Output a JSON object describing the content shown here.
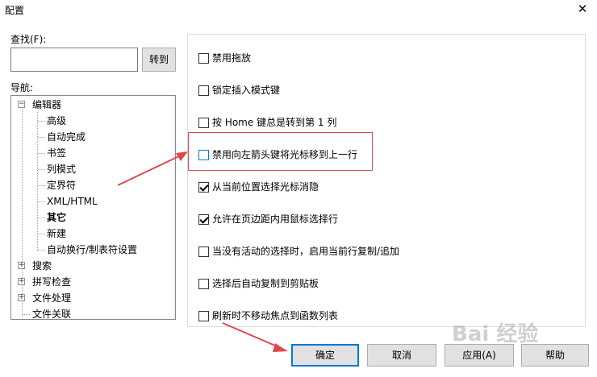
{
  "window": {
    "title": "配置",
    "close_glyph": "✕"
  },
  "find": {
    "label": "查找(F):",
    "value": "",
    "goto_label": "转到"
  },
  "nav": {
    "label": "导航:",
    "tree": [
      {
        "label": "编辑器",
        "level": 0,
        "toggle": "−"
      },
      {
        "label": "高级",
        "level": 1
      },
      {
        "label": "自动完成",
        "level": 1
      },
      {
        "label": "书签",
        "level": 1
      },
      {
        "label": "列模式",
        "level": 1
      },
      {
        "label": "定界符",
        "level": 1
      },
      {
        "label": "XML/HTML",
        "level": 1
      },
      {
        "label": "其它",
        "level": 1,
        "selected": true
      },
      {
        "label": "新建",
        "level": 1
      },
      {
        "label": "自动换行/制表符设置",
        "level": 1
      },
      {
        "label": "搜索",
        "level": 0,
        "toggle": "+"
      },
      {
        "label": "拼写检查",
        "level": 0,
        "toggle": "+"
      },
      {
        "label": "文件处理",
        "level": 0,
        "toggle": "+"
      },
      {
        "label": "文件关联",
        "level": 0
      }
    ]
  },
  "options": [
    {
      "label": "禁用拖放",
      "checked": false
    },
    {
      "label": "锁定插入模式键",
      "checked": false
    },
    {
      "label": "按 Home 键总是转到第 1 列",
      "checked": false
    },
    {
      "label": "禁用向左箭头键将光标移到上一行",
      "checked": false,
      "focused": true
    },
    {
      "label": "从当前位置选择光标消隐",
      "checked": true
    },
    {
      "label": "允许在页边距内用鼠标选择行",
      "checked": true
    },
    {
      "label": "当没有活动的选择时，启用当前行复制/追加",
      "checked": false
    },
    {
      "label": "选择后自动复制到剪贴板",
      "checked": false
    },
    {
      "label": "刷新时不移动焦点到函数列表",
      "checked": false
    }
  ],
  "buttons": {
    "ok": "确定",
    "cancel": "取消",
    "apply": "应用(A)",
    "help": "帮助"
  },
  "watermark": "Bai 经验",
  "colors": {
    "accent": "#0078d7",
    "annotation_red": "#e0474c"
  },
  "icons": {
    "close": "close-icon",
    "expand": "plus-box-icon",
    "collapse": "minus-box-icon",
    "arrow": "red-arrow-icon"
  }
}
